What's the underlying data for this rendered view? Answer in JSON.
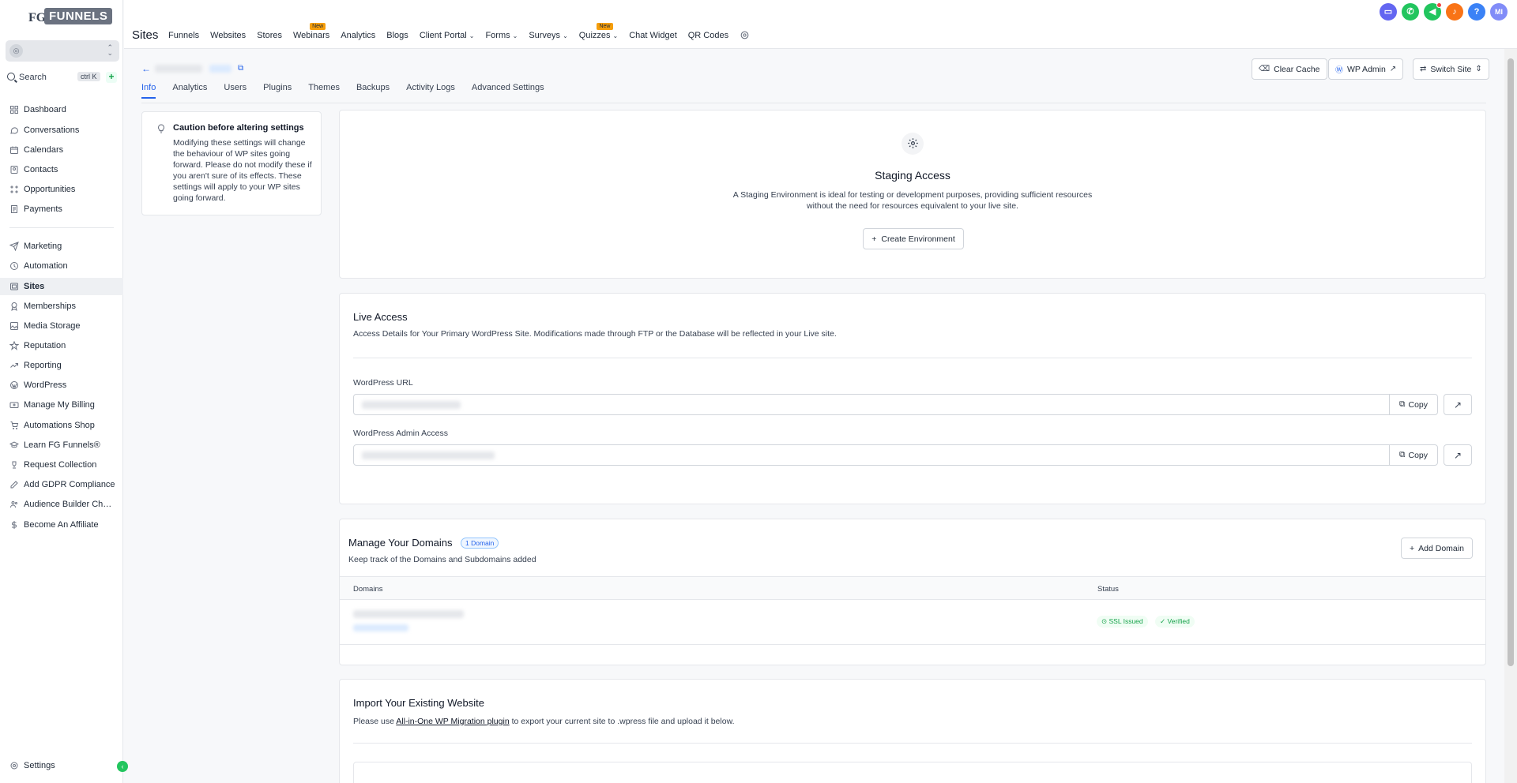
{
  "brand": {
    "logo_text": "FUNNELS",
    "logo_prefix": "FG"
  },
  "sidebar": {
    "search_label": "Search",
    "search_shortcut": "ctrl K",
    "items": [
      {
        "label": "Dashboard",
        "icon": "dashboard-icon"
      },
      {
        "label": "Conversations",
        "icon": "chat-icon"
      },
      {
        "label": "Calendars",
        "icon": "calendar-icon"
      },
      {
        "label": "Contacts",
        "icon": "contacts-icon"
      },
      {
        "label": "Opportunities",
        "icon": "opportunities-icon"
      },
      {
        "label": "Payments",
        "icon": "payments-icon"
      },
      {
        "label": "Marketing",
        "icon": "send-icon"
      },
      {
        "label": "Automation",
        "icon": "automation-icon"
      },
      {
        "label": "Sites",
        "icon": "sites-icon"
      },
      {
        "label": "Memberships",
        "icon": "badge-icon"
      },
      {
        "label": "Media Storage",
        "icon": "image-icon"
      },
      {
        "label": "Reputation",
        "icon": "star-icon"
      },
      {
        "label": "Reporting",
        "icon": "trend-icon"
      },
      {
        "label": "WordPress",
        "icon": "wordpress-icon"
      },
      {
        "label": "Manage My Billing",
        "icon": "billing-icon"
      },
      {
        "label": "Automations Shop",
        "icon": "cart-icon"
      },
      {
        "label": "Learn FG Funnels®",
        "icon": "graduation-icon"
      },
      {
        "label": "Request Collection",
        "icon": "trophy-icon"
      },
      {
        "label": "Add GDPR Compliance",
        "icon": "edit-icon"
      },
      {
        "label": "Audience Builder Challe...",
        "icon": "users-icon"
      },
      {
        "label": "Become An Affiliate",
        "icon": "dollar-icon"
      }
    ],
    "settings_label": "Settings"
  },
  "topbar": {
    "title": "Sites",
    "nav": [
      {
        "label": "Funnels"
      },
      {
        "label": "Websites"
      },
      {
        "label": "Stores"
      },
      {
        "label": "Webinars",
        "badge": "New"
      },
      {
        "label": "Analytics"
      },
      {
        "label": "Blogs"
      },
      {
        "label": "Client Portal",
        "dropdown": true
      },
      {
        "label": "Forms",
        "dropdown": true
      },
      {
        "label": "Surveys",
        "dropdown": true
      },
      {
        "label": "Quizzes",
        "badge": "New",
        "dropdown": true
      },
      {
        "label": "Chat Widget"
      },
      {
        "label": "QR Codes"
      }
    ],
    "avatar_initials": "MI",
    "help_glyph": "?"
  },
  "actions": {
    "clear_cache": "Clear Cache",
    "wp_admin": "WP Admin",
    "switch_site": "Switch Site"
  },
  "tabs": [
    "Info",
    "Analytics",
    "Users",
    "Plugins",
    "Themes",
    "Backups",
    "Activity Logs",
    "Advanced Settings"
  ],
  "caution": {
    "title": "Caution before altering settings",
    "body": "Modifying these settings will change the behaviour of WP sites going forward. Please do not modify these if you aren't sure of its effects. These settings will apply to your WP sites going forward."
  },
  "staging": {
    "title": "Staging Access",
    "desc_line1": "A Staging Environment is ideal for testing or development purposes, providing sufficient resources",
    "desc_line2": "without the need for resources equivalent to your live site.",
    "button": "Create Environment"
  },
  "live": {
    "title": "Live Access",
    "desc": "Access Details for Your Primary WordPress Site. Modifications made through FTP or the Database will be reflected in your Live site.",
    "url_label": "WordPress URL",
    "admin_label": "WordPress Admin Access",
    "copy_label": "Copy"
  },
  "domains": {
    "title": "Manage Your Domains",
    "count_badge": "1 Domain",
    "desc": "Keep track of the Domains and Subdomains added",
    "add_button": "Add Domain",
    "col_domains": "Domains",
    "col_status": "Status",
    "ssl": "SSL Issued",
    "verified": "Verified"
  },
  "import": {
    "title": "Import Your Existing Website",
    "desc_before": "Please use ",
    "link": "All-in-One WP Migration plugin",
    "desc_after": " to export your current site to .wpress file and upload it below."
  },
  "colors": {
    "accent": "#2563eb",
    "success": "#16a34a"
  }
}
